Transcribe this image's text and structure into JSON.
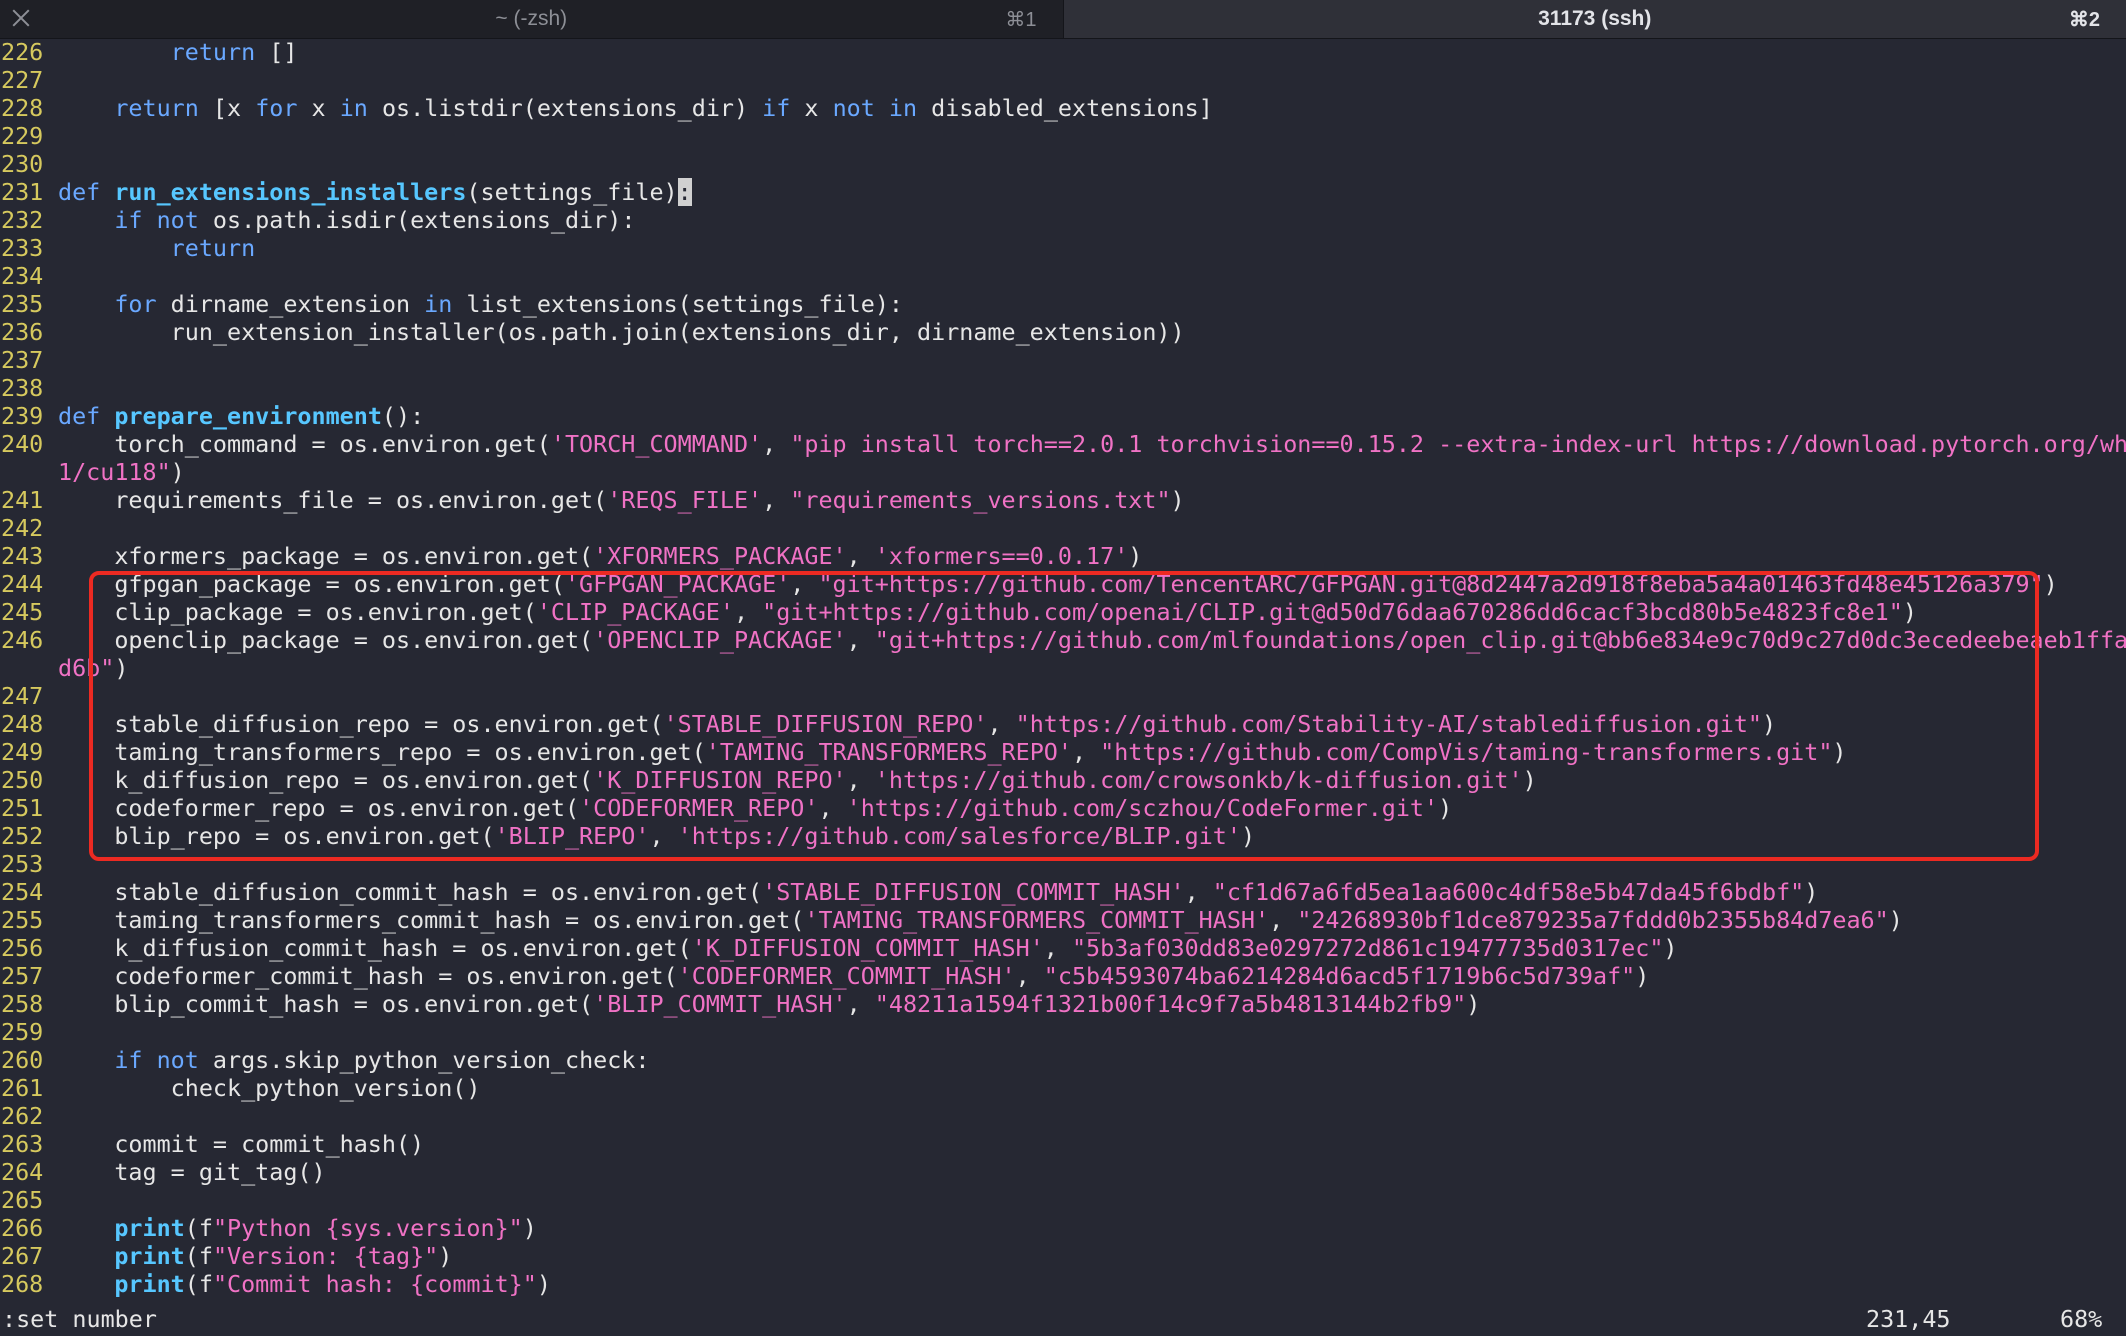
{
  "tabs": [
    {
      "label": "~ (-zsh)",
      "shortcut": "⌘1",
      "active": false
    },
    {
      "label": "31173 (ssh)",
      "shortcut": "⌘2",
      "active": true
    }
  ],
  "lines": [
    {
      "n": "226",
      "seg": [
        [
          "",
          "        "
        ],
        [
          "kw",
          "return"
        ],
        [
          "",
          " []"
        ]
      ]
    },
    {
      "n": "227",
      "seg": []
    },
    {
      "n": "228",
      "seg": [
        [
          "",
          "    "
        ],
        [
          "kw",
          "return"
        ],
        [
          "",
          " [x "
        ],
        [
          "kw",
          "for"
        ],
        [
          "",
          " x "
        ],
        [
          "kw",
          "in"
        ],
        [
          "",
          " os.listdir(extensions_dir) "
        ],
        [
          "kw",
          "if"
        ],
        [
          "",
          " x "
        ],
        [
          "kw",
          "not in"
        ],
        [
          "",
          " disabled_extensions]"
        ]
      ]
    },
    {
      "n": "229",
      "seg": []
    },
    {
      "n": "230",
      "seg": []
    },
    {
      "n": "231",
      "seg": [
        [
          "kw",
          "def"
        ],
        [
          "",
          " "
        ],
        [
          "fn",
          "run_extensions_installers"
        ],
        [
          "",
          "(settings_file)"
        ],
        [
          "cursor",
          ":"
        ]
      ]
    },
    {
      "n": "232",
      "seg": [
        [
          "",
          "    "
        ],
        [
          "kw",
          "if not"
        ],
        [
          "",
          " os.path.isdir(extensions_dir):"
        ]
      ]
    },
    {
      "n": "233",
      "seg": [
        [
          "",
          "        "
        ],
        [
          "kw",
          "return"
        ]
      ]
    },
    {
      "n": "234",
      "seg": []
    },
    {
      "n": "235",
      "seg": [
        [
          "",
          "    "
        ],
        [
          "kw",
          "for"
        ],
        [
          "",
          " dirname_extension "
        ],
        [
          "kw",
          "in"
        ],
        [
          "",
          " list_extensions(settings_file):"
        ]
      ]
    },
    {
      "n": "236",
      "seg": [
        [
          "",
          "        run_extension_installer(os.path.join(extensions_dir, dirname_extension))"
        ]
      ]
    },
    {
      "n": "237",
      "seg": []
    },
    {
      "n": "238",
      "seg": []
    },
    {
      "n": "239",
      "seg": [
        [
          "kw",
          "def"
        ],
        [
          "",
          " "
        ],
        [
          "fn",
          "prepare_environment"
        ],
        [
          "",
          "():"
        ]
      ]
    },
    {
      "n": "240",
      "seg": [
        [
          "",
          "    torch_command = os.environ.get("
        ],
        [
          "str",
          "'TORCH_COMMAND'"
        ],
        [
          "",
          ", "
        ],
        [
          "str",
          "\"pip install torch==2.0.1 torchvision==0.15.2 --extra-index-url https://download.pytorch.org/wh"
        ]
      ]
    },
    {
      "n": "",
      "seg": [
        [
          "str",
          "1/cu118\""
        ],
        [
          "",
          ")"
        ]
      ]
    },
    {
      "n": "241",
      "seg": [
        [
          "",
          "    requirements_file = os.environ.get("
        ],
        [
          "str",
          "'REQS_FILE'"
        ],
        [
          "",
          ", "
        ],
        [
          "str",
          "\"requirements_versions.txt\""
        ],
        [
          "",
          ")"
        ]
      ]
    },
    {
      "n": "242",
      "seg": []
    },
    {
      "n": "243",
      "seg": [
        [
          "",
          "    xformers_package = os.environ.get("
        ],
        [
          "str",
          "'XFORMERS_PACKAGE'"
        ],
        [
          "",
          ", "
        ],
        [
          "str",
          "'xformers==0.0.17'"
        ],
        [
          "",
          ")"
        ]
      ]
    },
    {
      "n": "244",
      "seg": [
        [
          "",
          "    gfpgan_package = os.environ.get("
        ],
        [
          "str",
          "'GFPGAN_PACKAGE'"
        ],
        [
          "",
          ", "
        ],
        [
          "str",
          "\"git+https://github.com/TencentARC/GFPGAN.git@8d2447a2d918f8eba5a4a01463fd48e45126a379\""
        ],
        [
          "",
          ")"
        ]
      ]
    },
    {
      "n": "245",
      "seg": [
        [
          "",
          "    clip_package = os.environ.get("
        ],
        [
          "str",
          "'CLIP_PACKAGE'"
        ],
        [
          "",
          ", "
        ],
        [
          "str",
          "\"git+https://github.com/openai/CLIP.git@d50d76daa670286dd6cacf3bcd80b5e4823fc8e1\""
        ],
        [
          "",
          ")"
        ]
      ]
    },
    {
      "n": "246",
      "seg": [
        [
          "",
          "    openclip_package = os.environ.get("
        ],
        [
          "str",
          "'OPENCLIP_PACKAGE'"
        ],
        [
          "",
          ", "
        ],
        [
          "str",
          "\"git+https://github.com/mlfoundations/open_clip.git@bb6e834e9c70d9c27d0dc3ecedeebeaeb1ffa"
        ]
      ]
    },
    {
      "n": "",
      "seg": [
        [
          "str",
          "d6b\""
        ],
        [
          "",
          ")"
        ]
      ]
    },
    {
      "n": "247",
      "seg": []
    },
    {
      "n": "248",
      "seg": [
        [
          "",
          "    stable_diffusion_repo = os.environ.get("
        ],
        [
          "str",
          "'STABLE_DIFFUSION_REPO'"
        ],
        [
          "",
          ", "
        ],
        [
          "str",
          "\"https://github.com/Stability-AI/stablediffusion.git\""
        ],
        [
          "",
          ")"
        ]
      ]
    },
    {
      "n": "249",
      "seg": [
        [
          "",
          "    taming_transformers_repo = os.environ.get("
        ],
        [
          "str",
          "'TAMING_TRANSFORMERS_REPO'"
        ],
        [
          "",
          ", "
        ],
        [
          "str",
          "\"https://github.com/CompVis/taming-transformers.git\""
        ],
        [
          "",
          ")"
        ]
      ]
    },
    {
      "n": "250",
      "seg": [
        [
          "",
          "    k_diffusion_repo = os.environ.get("
        ],
        [
          "str",
          "'K_DIFFUSION_REPO'"
        ],
        [
          "",
          ", "
        ],
        [
          "str",
          "'https://github.com/crowsonkb/k-diffusion.git'"
        ],
        [
          "",
          ")"
        ]
      ]
    },
    {
      "n": "251",
      "seg": [
        [
          "",
          "    codeformer_repo = os.environ.get("
        ],
        [
          "str",
          "'CODEFORMER_REPO'"
        ],
        [
          "",
          ", "
        ],
        [
          "str",
          "'https://github.com/sczhou/CodeFormer.git'"
        ],
        [
          "",
          ")"
        ]
      ]
    },
    {
      "n": "252",
      "seg": [
        [
          "",
          "    blip_repo = os.environ.get("
        ],
        [
          "str",
          "'BLIP_REPO'"
        ],
        [
          "",
          ", "
        ],
        [
          "str",
          "'https://github.com/salesforce/BLIP.git'"
        ],
        [
          "",
          ")"
        ]
      ]
    },
    {
      "n": "253",
      "seg": []
    },
    {
      "n": "254",
      "seg": [
        [
          "",
          "    stable_diffusion_commit_hash = os.environ.get("
        ],
        [
          "str",
          "'STABLE_DIFFUSION_COMMIT_HASH'"
        ],
        [
          "",
          ", "
        ],
        [
          "str",
          "\"cf1d67a6fd5ea1aa600c4df58e5b47da45f6bdbf\""
        ],
        [
          "",
          ")"
        ]
      ]
    },
    {
      "n": "255",
      "seg": [
        [
          "",
          "    taming_transformers_commit_hash = os.environ.get("
        ],
        [
          "str",
          "'TAMING_TRANSFORMERS_COMMIT_HASH'"
        ],
        [
          "",
          ", "
        ],
        [
          "str",
          "\"24268930bf1dce879235a7fddd0b2355b84d7ea6\""
        ],
        [
          "",
          ")"
        ]
      ]
    },
    {
      "n": "256",
      "seg": [
        [
          "",
          "    k_diffusion_commit_hash = os.environ.get("
        ],
        [
          "str",
          "'K_DIFFUSION_COMMIT_HASH'"
        ],
        [
          "",
          ", "
        ],
        [
          "str",
          "\"5b3af030dd83e0297272d861c19477735d0317ec\""
        ],
        [
          "",
          ")"
        ]
      ]
    },
    {
      "n": "257",
      "seg": [
        [
          "",
          "    codeformer_commit_hash = os.environ.get("
        ],
        [
          "str",
          "'CODEFORMER_COMMIT_HASH'"
        ],
        [
          "",
          ", "
        ],
        [
          "str",
          "\"c5b4593074ba6214284d6acd5f1719b6c5d739af\""
        ],
        [
          "",
          ")"
        ]
      ]
    },
    {
      "n": "258",
      "seg": [
        [
          "",
          "    blip_commit_hash = os.environ.get("
        ],
        [
          "str",
          "'BLIP_COMMIT_HASH'"
        ],
        [
          "",
          ", "
        ],
        [
          "str",
          "\"48211a1594f1321b00f14c9f7a5b4813144b2fb9\""
        ],
        [
          "",
          ")"
        ]
      ]
    },
    {
      "n": "259",
      "seg": []
    },
    {
      "n": "260",
      "seg": [
        [
          "",
          "    "
        ],
        [
          "kw",
          "if not"
        ],
        [
          "",
          " args.skip_python_version_check:"
        ]
      ]
    },
    {
      "n": "261",
      "seg": [
        [
          "",
          "        check_python_version()"
        ]
      ]
    },
    {
      "n": "262",
      "seg": []
    },
    {
      "n": "263",
      "seg": [
        [
          "",
          "    commit = commit_hash()"
        ]
      ]
    },
    {
      "n": "264",
      "seg": [
        [
          "",
          "    tag = git_tag()"
        ]
      ]
    },
    {
      "n": "265",
      "seg": []
    },
    {
      "n": "266",
      "seg": [
        [
          "",
          "    "
        ],
        [
          "fn",
          "print"
        ],
        [
          "",
          "(f"
        ],
        [
          "str",
          "\"Python {sys.version}\""
        ],
        [
          "",
          ")"
        ]
      ]
    },
    {
      "n": "267",
      "seg": [
        [
          "",
          "    "
        ],
        [
          "fn",
          "print"
        ],
        [
          "",
          "(f"
        ],
        [
          "str",
          "\"Version: {tag}\""
        ],
        [
          "",
          ")"
        ]
      ]
    },
    {
      "n": "268",
      "seg": [
        [
          "",
          "    "
        ],
        [
          "fn",
          "print"
        ],
        [
          "",
          "(f"
        ],
        [
          "str",
          "\"Commit hash: {commit}\""
        ],
        [
          "",
          ")"
        ]
      ]
    }
  ],
  "status": {
    "command": ":set number",
    "position": "231,45",
    "percent": "68%"
  }
}
